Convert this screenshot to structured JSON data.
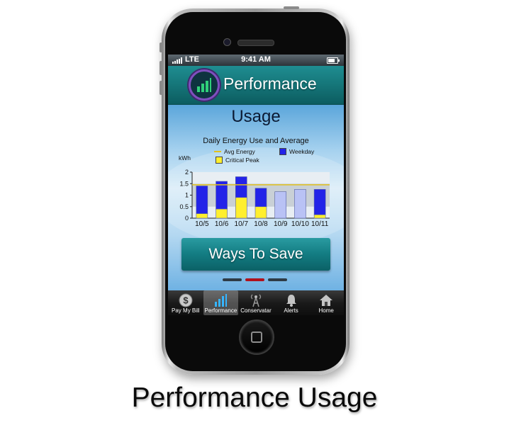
{
  "status_bar": {
    "carrier": "LTE",
    "time": "9:41 AM"
  },
  "header": {
    "title": "Performance",
    "logo_icon": "bar-chart-logo-icon"
  },
  "screen": {
    "heading": "Usage"
  },
  "chart_data": {
    "type": "bar",
    "title": "Daily Energy Use and Average",
    "ylabel": "kWh",
    "ylim": [
      0,
      2
    ],
    "yticks": [
      "0",
      "0.5",
      "1",
      "1.5",
      "2"
    ],
    "categories": [
      "10/5",
      "10/6",
      "10/7",
      "10/8",
      "10/9",
      "10/10",
      "10/11"
    ],
    "series": [
      {
        "name": "Critical Peak",
        "color": "#ffef2e",
        "values": [
          0.2,
          0.4,
          0.9,
          0.5,
          0,
          0,
          0.15
        ]
      },
      {
        "name": "Weekday",
        "color": "#2323e8",
        "values": [
          1.2,
          1.2,
          0.9,
          0.8,
          0,
          0,
          1.1
        ]
      },
      {
        "name": "",
        "color": "#b9c2f5",
        "values": [
          0,
          0,
          0,
          0,
          1.15,
          1.25,
          0
        ]
      }
    ],
    "average": {
      "name": "Avg Energy",
      "value": 1.45,
      "color": "#e2c11d"
    },
    "legend": [
      {
        "label": "Avg Energy",
        "kind": "line",
        "color": "#e2c11d"
      },
      {
        "label": "Weekday",
        "kind": "box",
        "color": "#2323e8"
      },
      {
        "label": "Critical Peak",
        "kind": "box",
        "color": "#ffef2e"
      }
    ],
    "grid": false,
    "legend_position": "top"
  },
  "cta": {
    "label": "Ways To Save"
  },
  "pager": {
    "pages": 3,
    "current": 2
  },
  "tabs": [
    {
      "label": "Pay My Bill",
      "icon": "dollar-coin-icon",
      "selected": false
    },
    {
      "label": "Performance",
      "icon": "bar-chart-icon",
      "selected": true
    },
    {
      "label": "Conservatar",
      "icon": "radio-tower-icon",
      "selected": false
    },
    {
      "label": "Alerts",
      "icon": "bell-icon",
      "selected": false
    },
    {
      "label": "Home",
      "icon": "home-icon",
      "selected": false
    }
  ],
  "caption": "Performance Usage",
  "colors": {
    "header_teal": "#16787b",
    "logo_ring": "#7f4fbe",
    "pager_active": "#b0111c"
  }
}
